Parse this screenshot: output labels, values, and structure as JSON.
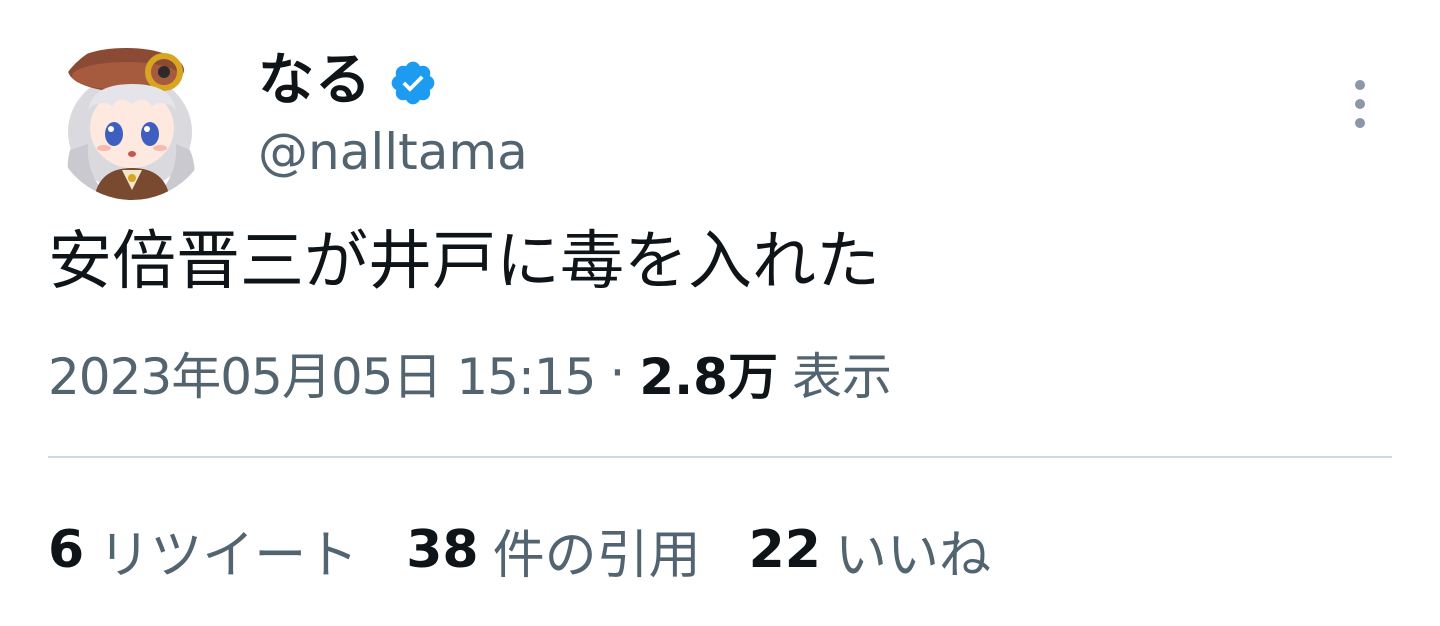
{
  "author": {
    "display_name": "なる",
    "handle": "@nalltama",
    "verified": true,
    "verified_color": "#1d9bf0",
    "avatar_icon": "anime-girl-avatar-icon"
  },
  "tweet": {
    "text": "安倍晋三が井戸に毒を入れた",
    "timestamp": "2023年05月05日 15:15",
    "separator": "·",
    "views_count": "2.8万",
    "views_label": "表示"
  },
  "stats": [
    {
      "count": "6",
      "label": "リツイート"
    },
    {
      "count": "38",
      "label": "件の引用"
    },
    {
      "count": "22",
      "label": "いいね"
    }
  ],
  "colors": {
    "text_primary": "#0f1419",
    "text_secondary": "#536471",
    "divider": "#cfd9de"
  }
}
